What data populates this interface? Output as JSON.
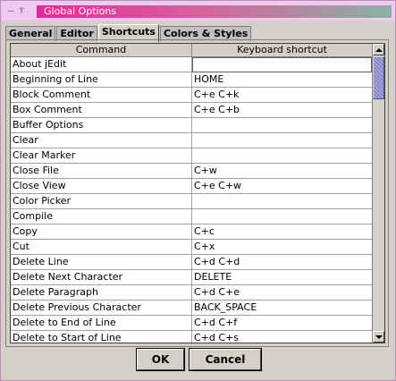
{
  "window": {
    "title": "Global Options",
    "controls": [
      "—",
      "⊤"
    ]
  },
  "tabs": [
    {
      "label": "General",
      "active": false
    },
    {
      "label": "Editor",
      "active": false
    },
    {
      "label": "Shortcuts",
      "active": true
    },
    {
      "label": "Colors & Styles",
      "active": false
    }
  ],
  "table": {
    "columns": [
      "Command",
      "Keyboard shortcut"
    ],
    "rows": [
      {
        "command": "About jEdit",
        "shortcut": ""
      },
      {
        "command": "Beginning of Line",
        "shortcut": "HOME"
      },
      {
        "command": "Block Comment",
        "shortcut": "C+e C+k"
      },
      {
        "command": "Box Comment",
        "shortcut": "C+e C+b"
      },
      {
        "command": "Buffer Options",
        "shortcut": ""
      },
      {
        "command": "Clear",
        "shortcut": ""
      },
      {
        "command": "Clear Marker",
        "shortcut": ""
      },
      {
        "command": "Close File",
        "shortcut": "C+w"
      },
      {
        "command": "Close View",
        "shortcut": "C+e C+w"
      },
      {
        "command": "Color Picker",
        "shortcut": ""
      },
      {
        "command": "Compile",
        "shortcut": ""
      },
      {
        "command": "Copy",
        "shortcut": "C+c"
      },
      {
        "command": "Cut",
        "shortcut": "C+x"
      },
      {
        "command": "Delete Line",
        "shortcut": "C+d C+d"
      },
      {
        "command": "Delete Next Character",
        "shortcut": "DELETE"
      },
      {
        "command": "Delete Paragraph",
        "shortcut": "C+d C+e"
      },
      {
        "command": "Delete Previous Character",
        "shortcut": "BACK_SPACE"
      },
      {
        "command": "Delete to End of Line",
        "shortcut": "C+d C+f"
      },
      {
        "command": "Delete to Start of Line",
        "shortcut": "C+d C+s"
      }
    ]
  },
  "buttons": {
    "ok": "OK",
    "cancel": "Cancel"
  },
  "colors": {
    "titlebar_start": "#e6289a",
    "titlebar_end": "#8ab2a4",
    "scroll_thumb": "#8080c0"
  },
  "icons": [
    "minimize-icon",
    "pin-icon",
    "scroll-up-icon",
    "scroll-down-icon"
  ]
}
